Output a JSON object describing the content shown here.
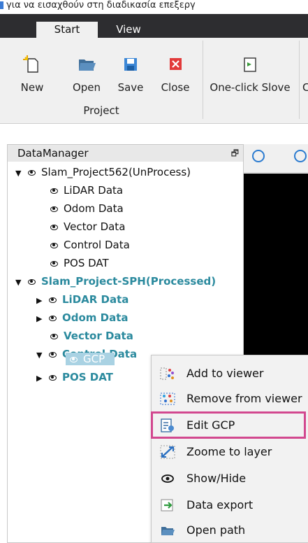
{
  "top_strip_text": "για να εισαχθούν στη διαδικασία επεξεργ",
  "tabs": [
    {
      "label": "Start"
    },
    {
      "label": "View"
    }
  ],
  "ribbon": {
    "buttons": [
      {
        "label": "New"
      },
      {
        "label": "Open"
      },
      {
        "label": "Save"
      },
      {
        "label": "Close"
      },
      {
        "label": "One-click Slove"
      }
    ],
    "group_label": "Project",
    "overflow_letter": "C"
  },
  "data_manager": {
    "title": "DataManager",
    "pin_glyph": "🗗",
    "projects": [
      {
        "name": "Slam_Project562(UnProcess)",
        "children": [
          {
            "label": "LiDAR Data"
          },
          {
            "label": "Odom Data"
          },
          {
            "label": "Vector Data"
          },
          {
            "label": "Control Data"
          },
          {
            "label": "POS DAT"
          }
        ]
      },
      {
        "name": "Slam_Project-SPH(Processed)",
        "children": [
          {
            "label": "LiDAR Data"
          },
          {
            "label": "Odom Data"
          },
          {
            "label": "Vector Data"
          },
          {
            "label": "Control Data",
            "children": [
              {
                "label": "GCP"
              }
            ]
          },
          {
            "label": "POS DAT"
          }
        ]
      }
    ]
  },
  "context_menu": {
    "items": [
      {
        "label": "Add to viewer",
        "icon": "add-to-viewer-icon"
      },
      {
        "label": "Remove from viewer",
        "icon": "remove-from-viewer-icon"
      },
      {
        "label": "Edit GCP",
        "icon": "edit-gcp-icon",
        "highlighted": true
      },
      {
        "label": "Zoome to layer",
        "icon": "zoom-to-layer-icon"
      },
      {
        "label": "Show/Hide",
        "icon": "eye-icon"
      },
      {
        "label": "Data export",
        "icon": "data-export-icon"
      },
      {
        "label": "Open path",
        "icon": "folder-icon"
      }
    ]
  },
  "colors": {
    "processed_text": "#2b8a9e",
    "selection": "#a9d2e3",
    "highlight_box": "#d2488f",
    "dark_chrome": "#2d2d30"
  }
}
